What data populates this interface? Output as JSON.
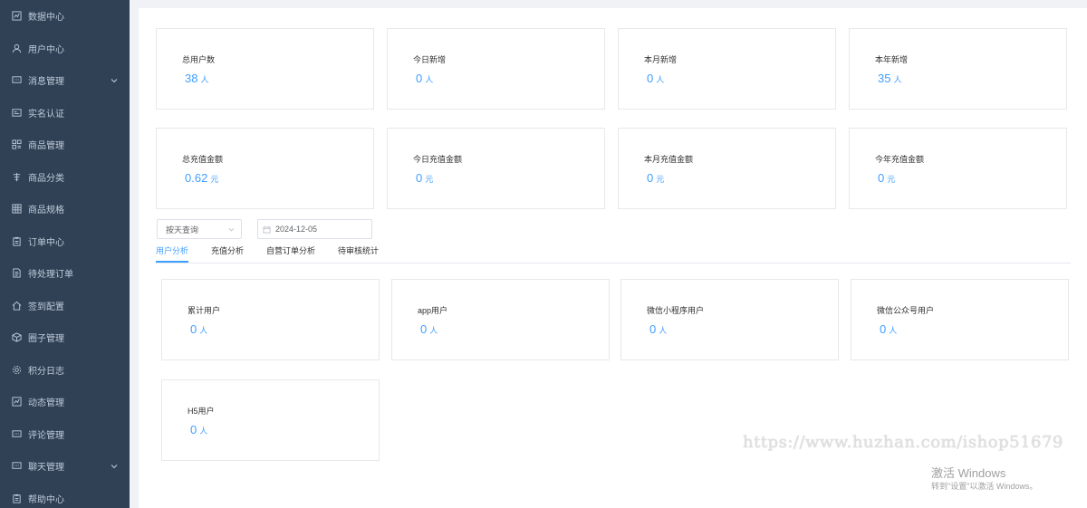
{
  "sidebar": {
    "items": [
      {
        "label": "数据中心",
        "icon": "chart-icon"
      },
      {
        "label": "用户中心",
        "icon": "user-icon"
      },
      {
        "label": "消息管理",
        "icon": "message-icon",
        "expandable": true
      },
      {
        "label": "实名认证",
        "icon": "id-card-icon"
      },
      {
        "label": "商品管理",
        "icon": "grid-icon"
      },
      {
        "label": "商品分类",
        "icon": "category-icon"
      },
      {
        "label": "商品规格",
        "icon": "table-icon"
      },
      {
        "label": "订单中心",
        "icon": "clipboard-icon"
      },
      {
        "label": "待处理订单",
        "icon": "document-icon"
      },
      {
        "label": "签到配置",
        "icon": "home-icon"
      },
      {
        "label": "圈子管理",
        "icon": "cube-icon"
      },
      {
        "label": "积分日志",
        "icon": "gear-icon"
      },
      {
        "label": "动态管理",
        "icon": "chart-icon"
      },
      {
        "label": "评论管理",
        "icon": "message-icon"
      },
      {
        "label": "聊天管理",
        "icon": "message-icon",
        "expandable": true
      },
      {
        "label": "帮助中心",
        "icon": "clipboard-icon"
      }
    ]
  },
  "stats_top": [
    {
      "label": "总用户数",
      "value": "38",
      "unit": "人"
    },
    {
      "label": "今日新增",
      "value": "0",
      "unit": "人"
    },
    {
      "label": "本月新增",
      "value": "0",
      "unit": "人"
    },
    {
      "label": "本年新增",
      "value": "35",
      "unit": "人"
    }
  ],
  "stats_recharge": [
    {
      "label": "总充值金额",
      "value": "0.62",
      "unit": "元"
    },
    {
      "label": "今日充值金额",
      "value": "0",
      "unit": "元"
    },
    {
      "label": "本月充值金额",
      "value": "0",
      "unit": "元"
    },
    {
      "label": "今年充值金额",
      "value": "0",
      "unit": "元"
    }
  ],
  "filters": {
    "query_mode": "按天查询",
    "date": "2024-12-05"
  },
  "tabs": [
    {
      "label": "用户分析",
      "active": true
    },
    {
      "label": "充值分析",
      "active": false
    },
    {
      "label": "自营订单分析",
      "active": false
    },
    {
      "label": "待审核统计",
      "active": false
    }
  ],
  "user_analysis": [
    {
      "label": "累计用户",
      "value": "0",
      "unit": "人"
    },
    {
      "label": "app用户",
      "value": "0",
      "unit": "人"
    },
    {
      "label": "微信小程序用户",
      "value": "0",
      "unit": "人"
    },
    {
      "label": "微信公众号用户",
      "value": "0",
      "unit": "人"
    },
    {
      "label": "H5用户",
      "value": "0",
      "unit": "人"
    }
  ],
  "watermark": "https://www.huzhan.com/ishop51679",
  "os_notice": {
    "line1": "激活 Windows",
    "line2": "转到\"设置\"以激活 Windows。"
  },
  "colors": {
    "sidebar_bg": "#304156",
    "accent": "#409eff"
  }
}
